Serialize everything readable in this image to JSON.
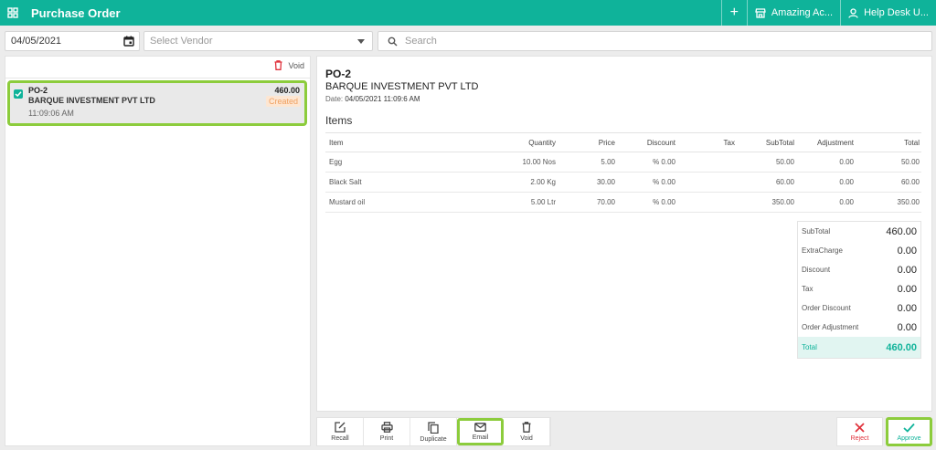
{
  "app": {
    "title": "Purchase Order",
    "plus_label": "+",
    "store_label": "Amazing Ac...",
    "help_label": "Help Desk U..."
  },
  "filters": {
    "date_value": "04/05/2021",
    "vendor_placeholder": "Select Vendor",
    "search_placeholder": "Search"
  },
  "list": {
    "void_label": "Void",
    "orders": [
      {
        "po": "PO-2",
        "vendor": "BARQUE INVESTMENT PVT LTD",
        "time": "11:09:06 AM",
        "amount": "460.00",
        "status": "Created",
        "checked": true
      }
    ]
  },
  "detail": {
    "po": "PO-2",
    "vendor": "BARQUE INVESTMENT PVT LTD",
    "date_label": "Date:",
    "date_value": "04/05/2021 11:09:6 AM",
    "items_heading": "Items",
    "columns": [
      "Item",
      "Quantity",
      "Price",
      "Discount",
      "Tax",
      "SubTotal",
      "Adjustment",
      "Total"
    ],
    "rows": [
      [
        "Egg",
        "10.00 Nos",
        "5.00",
        "% 0.00",
        "",
        "50.00",
        "0.00",
        "50.00"
      ],
      [
        "Black Salt",
        "2.00 Kg",
        "30.00",
        "% 0.00",
        "",
        "60.00",
        "0.00",
        "60.00"
      ],
      [
        "Mustard oil",
        "5.00 Ltr",
        "70.00",
        "% 0.00",
        "",
        "350.00",
        "0.00",
        "350.00"
      ]
    ],
    "summary": [
      {
        "label": "SubTotal",
        "value": "460.00"
      },
      {
        "label": "ExtraCharge",
        "value": "0.00"
      },
      {
        "label": "Discount",
        "value": "0.00"
      },
      {
        "label": "Tax",
        "value": "0.00"
      },
      {
        "label": "Order Discount",
        "value": "0.00"
      },
      {
        "label": "Order Adjustment",
        "value": "0.00"
      },
      {
        "label": "Total",
        "value": "460.00"
      }
    ]
  },
  "actions": {
    "recall": "Recall",
    "print": "Print",
    "duplicate": "Duplicate",
    "email": "Email",
    "void": "Void",
    "reject": "Reject",
    "approve": "Approve"
  },
  "colors": {
    "brand": "#0fb39a",
    "highlight": "#8ccc3c",
    "status_created": "#f0a060",
    "reject": "#e0333d"
  }
}
